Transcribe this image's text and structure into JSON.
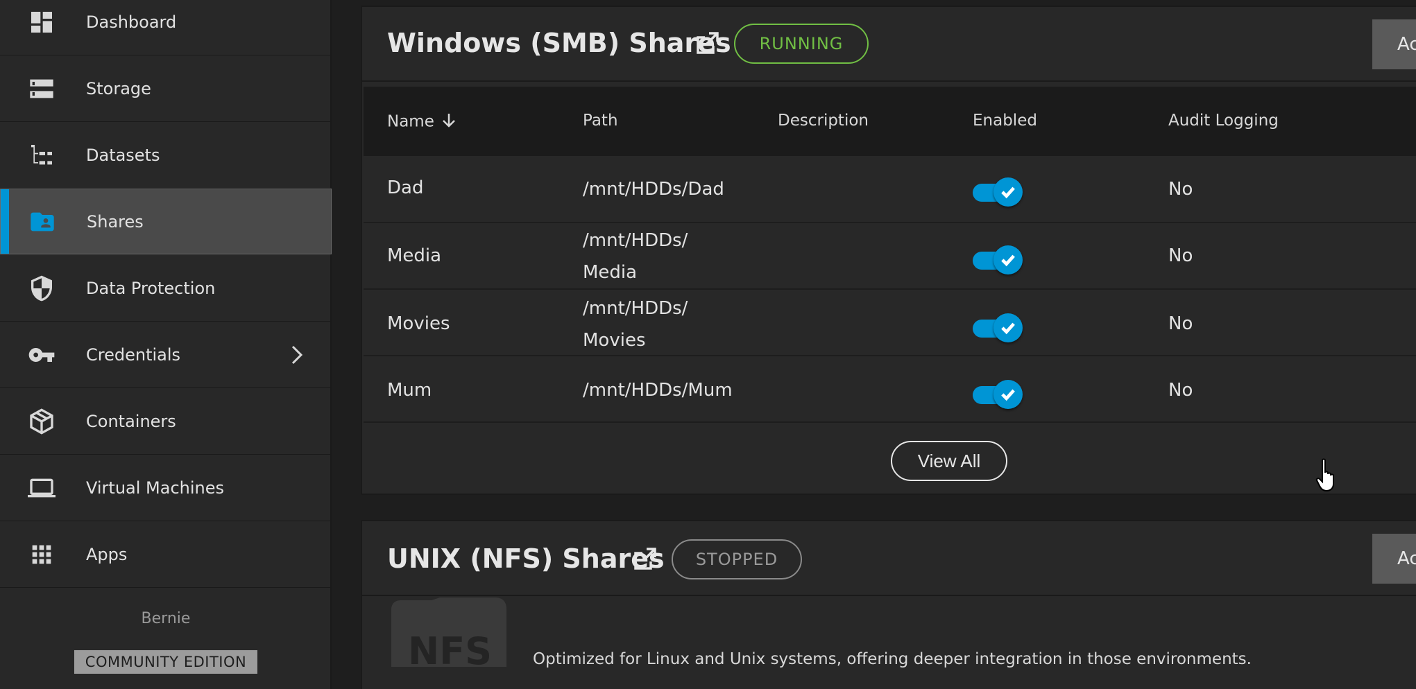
{
  "sidebar": {
    "items": [
      {
        "label": "Dashboard",
        "icon": "dashboard-icon"
      },
      {
        "label": "Storage",
        "icon": "storage-icon"
      },
      {
        "label": "Datasets",
        "icon": "datasets-icon"
      },
      {
        "label": "Shares",
        "icon": "shares-folder-icon",
        "active": true
      },
      {
        "label": "Data Protection",
        "icon": "shield-icon"
      },
      {
        "label": "Credentials",
        "icon": "key-icon",
        "has_submenu": true
      },
      {
        "label": "Containers",
        "icon": "cube-icon"
      },
      {
        "label": "Virtual Machines",
        "icon": "laptop-icon"
      },
      {
        "label": "Apps",
        "icon": "apps-grid-icon"
      }
    ],
    "hostname": "Bernie",
    "edition": "COMMUNITY EDITION"
  },
  "smb": {
    "title": "Windows (SMB) Shares",
    "status": "RUNNING",
    "status_color": "#71bf44",
    "add_label": "Ac",
    "columns": [
      "Name",
      "Path",
      "Description",
      "Enabled",
      "Audit Logging"
    ],
    "rows": [
      {
        "name": "Dad",
        "path_line1": "/mnt/HDDs/Dad",
        "path_line2": "",
        "description": "",
        "enabled": true,
        "audit": "No"
      },
      {
        "name": "Media",
        "path_line1": "/mnt/HDDs/",
        "path_line2": "Media",
        "description": "",
        "enabled": true,
        "audit": "No"
      },
      {
        "name": "Movies",
        "path_line1": "/mnt/HDDs/",
        "path_line2": "Movies",
        "description": "",
        "enabled": true,
        "audit": "No"
      },
      {
        "name": "Mum",
        "path_line1": "/mnt/HDDs/Mum",
        "path_line2": "",
        "description": "",
        "enabled": true,
        "audit": "No"
      }
    ],
    "view_all_label": "View All"
  },
  "nfs": {
    "title": "UNIX (NFS) Shares",
    "status": "STOPPED",
    "add_label": "Ac",
    "icon_text": "NFS",
    "description": "Optimized for Linux and Unix systems, offering deeper integration in those environments."
  },
  "colors": {
    "accent": "#0095d5",
    "running": "#71bf44",
    "stopped": "#9a9a9a"
  }
}
